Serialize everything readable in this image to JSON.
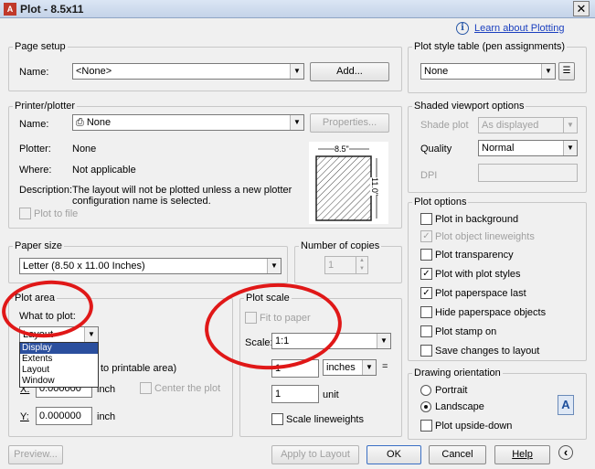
{
  "window": {
    "title": "Plot - 8.5x11",
    "close": "✕"
  },
  "help_link": "Learn about Plotting",
  "page_setup": {
    "group": "Page setup",
    "name_label": "Name:",
    "name_value": "<None>",
    "add_button": "Add..."
  },
  "printer": {
    "group": "Printer/plotter",
    "name_label": "Name:",
    "name_value": "None",
    "properties_button": "Properties...",
    "plotter_label": "Plotter:",
    "plotter_value": "None",
    "where_label": "Where:",
    "where_value": "Not applicable",
    "description_label": "Description:",
    "description_value_1": "The layout will not be plotted unless a new plotter",
    "description_value_2": "configuration name is selected.",
    "plot_to_file": "Plot to file",
    "preview_width": "8.5\"",
    "preview_height": "11.0\""
  },
  "paper_size": {
    "group": "Paper size",
    "value": "Letter (8.50 x 11.00 Inches)"
  },
  "copies": {
    "group": "Number of copies",
    "value": "1"
  },
  "plot_area": {
    "group": "Plot area",
    "what_label": "What to plot:",
    "value": "Layout",
    "options": [
      "Display",
      "Extents",
      "Layout",
      "Window"
    ],
    "selected_option": "Display"
  },
  "offset": {
    "group_suffix": "to printable area)",
    "center": "Center the plot",
    "x_label": "X:",
    "x_value": "0.000000",
    "x_unit": "inch",
    "y_label": "Y:",
    "y_value": "0.000000",
    "y_unit": "inch"
  },
  "plot_scale": {
    "group": "Plot scale",
    "fit": "Fit to paper",
    "scale_label": "Scale:",
    "scale_value": "1:1",
    "val1": "1",
    "unit1": "inches",
    "eq": "=",
    "val2": "1",
    "unit2": "unit",
    "lineweights": "Scale lineweights"
  },
  "style_table": {
    "group": "Plot style table (pen assignments)",
    "value": "None"
  },
  "shaded": {
    "group": "Shaded viewport options",
    "shade_label": "Shade plot",
    "shade_value": "As displayed",
    "quality_label": "Quality",
    "quality_value": "Normal",
    "dpi_label": "DPI"
  },
  "plot_options": {
    "group": "Plot options",
    "items": [
      {
        "label": "Plot in background",
        "checked": false,
        "disabled": false
      },
      {
        "label": "Plot object lineweights",
        "checked": true,
        "disabled": true
      },
      {
        "label": "Plot transparency",
        "checked": false,
        "disabled": false
      },
      {
        "label": "Plot with plot styles",
        "checked": true,
        "disabled": false
      },
      {
        "label": "Plot paperspace last",
        "checked": true,
        "disabled": false
      },
      {
        "label": "Hide paperspace objects",
        "checked": false,
        "disabled": false
      },
      {
        "label": "Plot stamp on",
        "checked": false,
        "disabled": false
      },
      {
        "label": "Save changes to layout",
        "checked": false,
        "disabled": false
      }
    ]
  },
  "orientation": {
    "group": "Drawing orientation",
    "portrait": "Portrait",
    "landscape": "Landscape",
    "upside": "Plot upside-down",
    "selected": "Landscape",
    "preview_letter": "A"
  },
  "footer": {
    "preview": "Preview...",
    "apply": "Apply to Layout",
    "ok": "OK",
    "cancel": "Cancel",
    "help": "Help",
    "expand": "‹"
  },
  "colors": {
    "annotation": "#e01818",
    "link": "#1a3fbf",
    "selection": "#2b4f9e"
  }
}
